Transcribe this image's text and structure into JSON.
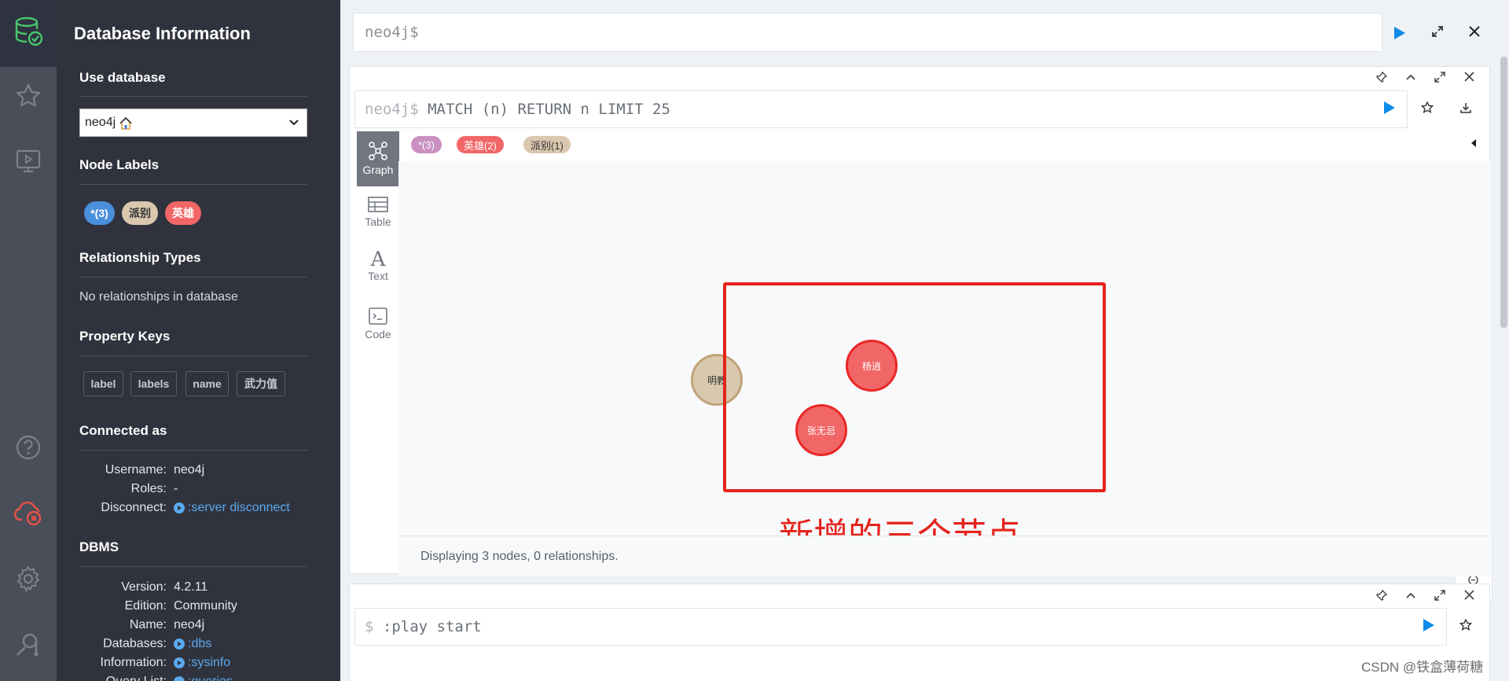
{
  "drawer": {
    "title": "Database Information",
    "use_database": "Use database",
    "selected_db": "neo4j",
    "node_labels_title": "Node Labels",
    "node_labels": [
      {
        "text": "*(3)",
        "bg": "#4a8fdb",
        "fg": "#ffffff"
      },
      {
        "text": "派别",
        "bg": "#d9c8ae",
        "fg": "#333333"
      },
      {
        "text": "英雄",
        "bg": "#f16667",
        "fg": "#ffffff"
      }
    ],
    "rel_types_title": "Relationship Types",
    "rel_types_text": "No relationships in database",
    "prop_keys_title": "Property Keys",
    "prop_keys": [
      "label",
      "labels",
      "name",
      "武力值"
    ],
    "connected_title": "Connected as",
    "connected": {
      "username_key": "Username:",
      "username": "neo4j",
      "roles_key": "Roles:",
      "roles": "-",
      "disconnect_key": "Disconnect:",
      "disconnect": ":server disconnect"
    },
    "dbms_title": "DBMS",
    "dbms": {
      "version_key": "Version:",
      "version": "4.2.11",
      "edition_key": "Edition:",
      "edition": "Community",
      "name_key": "Name:",
      "name": "neo4j",
      "databases_key": "Databases:",
      "databases": ":dbs",
      "information_key": "Information:",
      "information": ":sysinfo",
      "querylist_key": "Query List:",
      "querylist": ":queries"
    }
  },
  "main": {
    "top_editor": "neo4j$",
    "frame1": {
      "prompt": "neo4j$",
      "query": " MATCH (n) RETURN n LIMIT 25",
      "tabs": [
        "Graph",
        "Table",
        "Text",
        "Code"
      ],
      "pills": [
        {
          "text": "*(3)",
          "bg": "#c990c0",
          "fg": "#ffffff"
        },
        {
          "text": "英雄(2)",
          "bg": "#f16667",
          "fg": "#ffffff"
        },
        {
          "text": "派别(1)",
          "bg": "#d9c8ae",
          "fg": "#333333"
        }
      ],
      "nodes": [
        {
          "label": "明教",
          "bg": "#d9c8ae",
          "border": "#c0a378",
          "fg": "#333333"
        },
        {
          "label": "杨逍",
          "bg": "#f16667",
          "border": "#eb2728",
          "fg": "#ffffff"
        },
        {
          "label": "张无忌",
          "bg": "#f16667",
          "border": "#eb2728",
          "fg": "#ffffff"
        }
      ],
      "annotation": "新增的三个节点",
      "status": "Displaying 3 nodes, 0 relationships."
    },
    "frame2": {
      "prompt": "$",
      "query": " :play start"
    },
    "watermark": "CSDN @铁盒薄荷糖"
  },
  "colors": {
    "accent": "#0c8be8",
    "annotation_red": "#e5231b",
    "nav_bg": "#4a4e58",
    "drawer_bg": "#30333d"
  }
}
